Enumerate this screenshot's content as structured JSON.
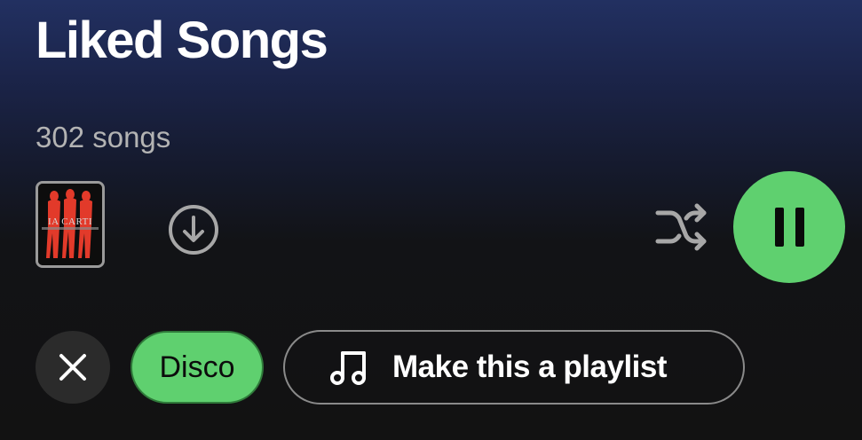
{
  "header": {
    "title": "Liked Songs",
    "song_count": "302 songs"
  },
  "album": {
    "cover_text": "IA CARTI"
  },
  "controls": {
    "download_icon": "download-circle-icon",
    "shuffle_icon": "shuffle-icon",
    "pause_icon": "pause-icon",
    "accent_color": "#5fd06f"
  },
  "filters": {
    "clear_icon": "close-icon",
    "active_filter": "Disco",
    "make_playlist_label": "Make this a playlist",
    "make_playlist_icon": "music-note-icon"
  }
}
